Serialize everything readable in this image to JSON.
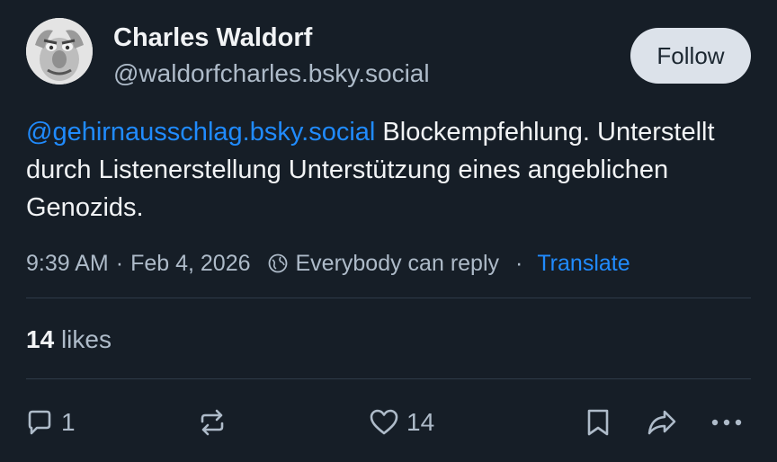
{
  "author": {
    "display_name": "Charles Waldorf",
    "handle": "@waldorfcharles.bsky.social"
  },
  "follow_label": "Follow",
  "post": {
    "mention": "@gehirnausschlag.bsky.social",
    "text": " Blockempfehlung. Unterstellt durch Listenerstellung Unterstützung eines angeblichen Genozids."
  },
  "meta": {
    "time": "9:39 AM",
    "separator": "·",
    "date": "Feb 4, 2026",
    "reply_setting": "Everybody can reply",
    "translate_label": "Translate"
  },
  "likes": {
    "count": "14",
    "label": "likes"
  },
  "actions": {
    "reply_count": "1",
    "like_count": "14"
  },
  "colors": {
    "background": "#161e27",
    "accent": "#208bfe",
    "muted": "#aebbc9"
  }
}
